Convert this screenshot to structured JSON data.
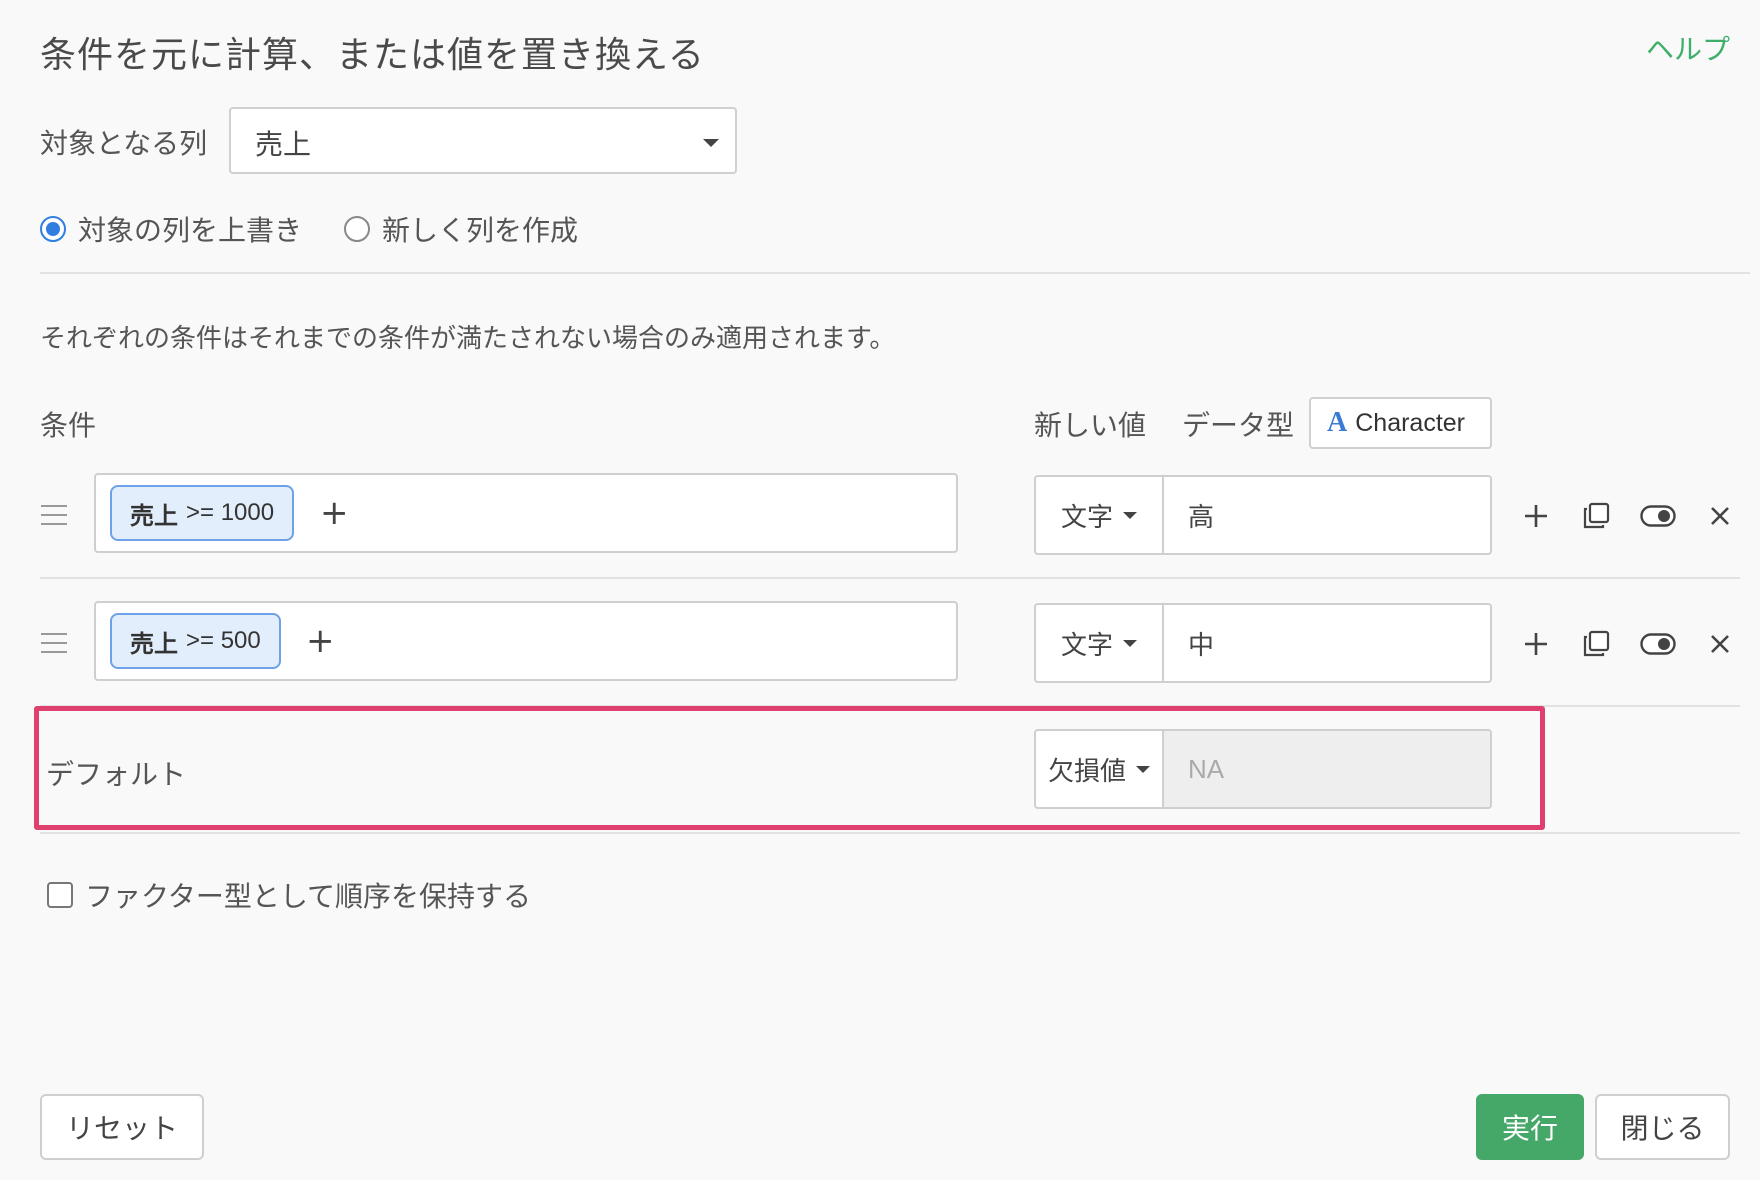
{
  "dialog": {
    "title": "条件を元に計算、または値を置き換える",
    "help_label": "ヘルプ"
  },
  "target": {
    "label": "対象となる列",
    "selected": "売上"
  },
  "mode": {
    "options": [
      {
        "label": "対象の列を上書き",
        "checked": true
      },
      {
        "label": "新しく列を作成",
        "checked": false
      }
    ]
  },
  "note": "それぞれの条件はそれまでの条件が満たされない場合のみ適用されます。",
  "headers": {
    "condition": "条件",
    "new_value": "新しい値",
    "data_type": "データ型",
    "data_type_icon": "A",
    "data_type_value": "Character"
  },
  "rules": [
    {
      "chip_column": "売上",
      "chip_expr": ">= 1000",
      "value_type": "文字",
      "value": "高"
    },
    {
      "chip_column": "売上",
      "chip_expr": ">= 500",
      "value_type": "文字",
      "value": "中"
    }
  ],
  "default_row": {
    "label": "デフォルト",
    "value_type": "欠損値",
    "value": "NA"
  },
  "factor_option": {
    "label": "ファクター型として順序を保持する",
    "checked": false
  },
  "buttons": {
    "reset": "リセット",
    "run": "実行",
    "close": "閉じる"
  },
  "colors": {
    "accent_green": "#46a868",
    "highlight": "#e0406f",
    "chip_border": "#6ea2e6",
    "radio_blue": "#2f7ee0"
  }
}
